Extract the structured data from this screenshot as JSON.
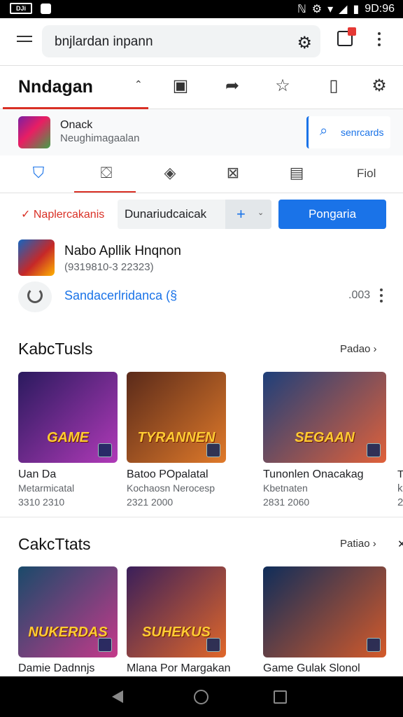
{
  "status_bar": {
    "left_icon_text": "DJi",
    "time": "9D:96"
  },
  "search": {
    "value": "bnjlardan inpann"
  },
  "app_bar": {
    "title": "Nndagan"
  },
  "game_card": {
    "title": "Onack",
    "subtitle": "Neughimagaalan",
    "search_label": "senrcards"
  },
  "nav": {
    "last_label": "Fiol"
  },
  "filter": {
    "label": "Naplercakanis",
    "select_value": "Dunariudcaicak",
    "primary_button": "Pongaria"
  },
  "app": {
    "name": "Nabo Apllik Hnqnon",
    "meta": "(9319810-3 22323)",
    "link": "Sandacerlridanca (§",
    "count": ".003"
  },
  "sections": [
    {
      "title": "KabcTusls",
      "more": "Padao ›",
      "items": [
        {
          "art": "GAME",
          "name": "Uan Da",
          "sub": "Metarmicatal",
          "date": "3310 2310",
          "colors": [
            "#2a1a5e",
            "#b03ab8"
          ]
        },
        {
          "art": "TYRANNEN",
          "name": "Batoo POpalatal",
          "sub": "Kochaosn Nerocesp",
          "date": "2321 2000",
          "colors": [
            "#5a2a1a",
            "#e07a2a"
          ]
        },
        {
          "art": "SEGAAN",
          "name": "Tunonlen Onacakag",
          "sub": "Kbetnaten",
          "date": "2831 2060",
          "colors": [
            "#1e3f7a",
            "#e0613a"
          ]
        }
      ]
    },
    {
      "title": "CakcTtats",
      "more": "Patiao ›",
      "items": [
        {
          "art": "NUKERDAS",
          "name": "Damie Dadnnjs",
          "sub": "",
          "date": "",
          "colors": [
            "#1a4a6a",
            "#c43a8a"
          ]
        },
        {
          "art": "SUHEKUS",
          "name": "Mlana Por Margakan",
          "sub": "",
          "date": "",
          "colors": [
            "#3a1f5a",
            "#e0672a"
          ]
        },
        {
          "art": "",
          "name": "Game Gulak Slonol",
          "sub": "",
          "date": "",
          "colors": [
            "#0f2d5a",
            "#d45a2a"
          ]
        }
      ]
    }
  ],
  "peek": {
    "row1_name": "T",
    "row1_sub": "k",
    "row1_date": "2",
    "row2_more": "✕"
  }
}
